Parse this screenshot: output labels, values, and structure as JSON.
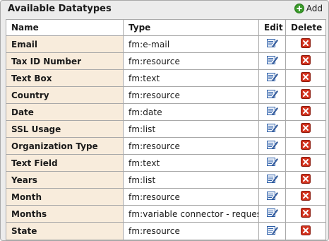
{
  "panel": {
    "title": "Available Datatypes",
    "add_label": "Add"
  },
  "table": {
    "columns": [
      "Name",
      "Type",
      "Edit",
      "Delete"
    ],
    "rows": [
      {
        "name": "Email",
        "type": "fm:e-mail"
      },
      {
        "name": "Tax ID Number",
        "type": "fm:resource"
      },
      {
        "name": "Text Box",
        "type": "fm:text"
      },
      {
        "name": "Country",
        "type": "fm:resource"
      },
      {
        "name": "Date",
        "type": "fm:date"
      },
      {
        "name": "SSL Usage",
        "type": "fm:list"
      },
      {
        "name": "Organization Type",
        "type": "fm:resource"
      },
      {
        "name": "Text Field",
        "type": "fm:text"
      },
      {
        "name": "Years",
        "type": "fm:list"
      },
      {
        "name": "Month",
        "type": "fm:resource"
      },
      {
        "name": "Months",
        "type": "fm:variable connector - request"
      },
      {
        "name": "State",
        "type": "fm:resource"
      }
    ]
  },
  "icons": {
    "add": "add-icon",
    "edit": "edit-icon",
    "delete": "delete-icon"
  },
  "colors": {
    "name_cell_bg": "#f8ecdc",
    "add_green": "#3a9a2a",
    "delete_red": "#d2321e",
    "edit_blue": "#2d5fa8"
  }
}
